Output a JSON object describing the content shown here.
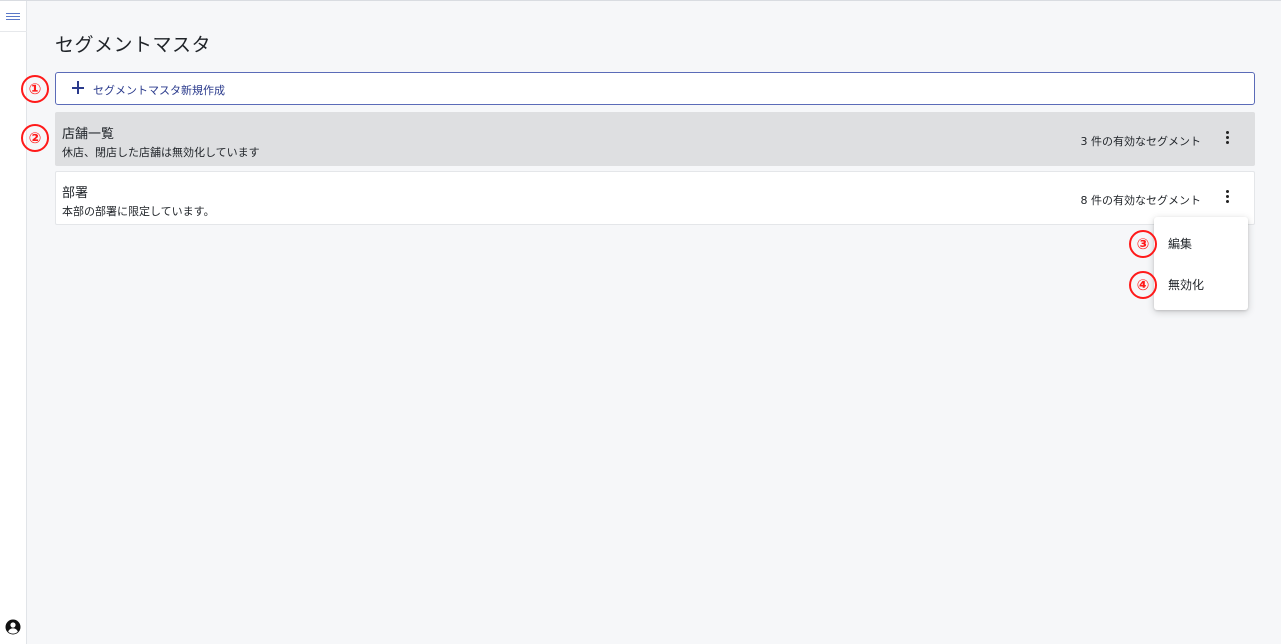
{
  "page": {
    "title": "セグメントマスタ"
  },
  "toolbar": {
    "create_label": "セグメントマスタ新規作成"
  },
  "segments": [
    {
      "name": "店舗一覧",
      "description": "休店、閉店した店舗は無効化しています",
      "count_label": "3 件の有効なセグメント",
      "highlighted": true
    },
    {
      "name": "部署",
      "description": "本部の部署に限定しています。",
      "count_label": "8 件の有効なセグメント",
      "highlighted": false
    }
  ],
  "context_menu": {
    "items": [
      {
        "label": "編集"
      },
      {
        "label": "無効化"
      }
    ]
  },
  "annotations": [
    "①",
    "②",
    "③",
    "④"
  ],
  "icons": {
    "menu": "hamburger-icon",
    "account": "account-circle-icon",
    "add": "plus-icon",
    "more": "more-vertical-icon"
  },
  "colors": {
    "accent": "#2a3a8c",
    "annotation": "#ff1a1a",
    "highlight_row": "#dedfe1",
    "background": "#f6f7f9"
  }
}
